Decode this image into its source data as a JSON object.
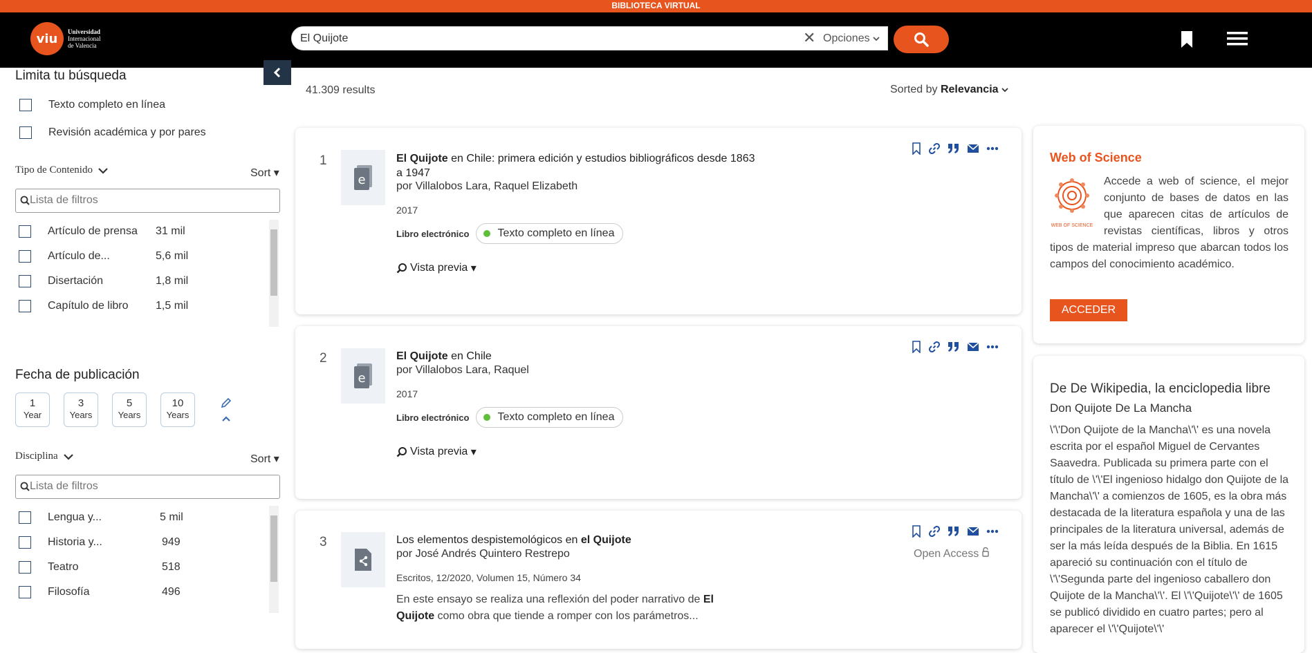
{
  "banner": "BIBLIOTECA VIRTUAL",
  "logo": {
    "mark": "viu",
    "line1": "Universidad",
    "line2": "Internacional",
    "line3": "de Valencia"
  },
  "search": {
    "value": "El Quijote",
    "options_label": "Opciones",
    "icon": "search-icon"
  },
  "sidebar": {
    "title": "Limita tu búsqueda",
    "checks": [
      "Texto completo en línea",
      "Revisión académica y por pares"
    ],
    "tipo": {
      "heading": "Tipo de Contenido",
      "sort": "Sort",
      "filter_placeholder": "Lista de filtros",
      "items": [
        {
          "label": "Artículo de prensa",
          "count": "31 mil"
        },
        {
          "label": "Artículo de...",
          "count": "5,6 mil"
        },
        {
          "label": "Disertación",
          "count": "1,8 mil"
        },
        {
          "label": "Capítulo de libro",
          "count": "1,5 mil"
        }
      ]
    },
    "fecha": {
      "heading": "Fecha de publicación",
      "buttons": [
        {
          "n": "1",
          "u": "Year"
        },
        {
          "n": "3",
          "u": "Years"
        },
        {
          "n": "5",
          "u": "Years"
        },
        {
          "n": "10",
          "u": "Years"
        }
      ]
    },
    "disciplina": {
      "heading": "Disciplina",
      "sort": "Sort",
      "filter_placeholder": "Lista de filtros",
      "items": [
        {
          "label": "Lengua y...",
          "count": "5 mil"
        },
        {
          "label": "Historia y...",
          "count": "949"
        },
        {
          "label": "Teatro",
          "count": "518"
        },
        {
          "label": "Filosofía",
          "count": "496"
        }
      ]
    }
  },
  "results": {
    "count": "41.309 results",
    "sorted_prefix": "Sorted by",
    "sorted_value": "Relevancia",
    "items": [
      {
        "rank": "1",
        "title_bold": "El Quijote",
        "title_rest": " en Chile: primera edición y estudios bibliográficos desde 1863 a 1947",
        "author_prefix": "por",
        "author": "Villalobos Lara, Raquel Elizabeth",
        "date": "2017",
        "type": "Libro electrónico",
        "availability": "Texto completo en línea",
        "preview": "Vista previa"
      },
      {
        "rank": "2",
        "title_bold": "El Quijote",
        "title_rest": " en Chile",
        "author_prefix": "por",
        "author": "Villalobos Lara, Raquel",
        "date": "2017",
        "type": "Libro electrónico",
        "availability": "Texto completo en línea",
        "preview": "Vista previa"
      },
      {
        "rank": "3",
        "title_rest": "Los elementos despistemológicos en ",
        "title_bold": "el Quijote",
        "author_prefix": "por",
        "author": "José Andrés Quintero Restrepo",
        "date": "Escritos, 12/2020, Volumen 15, Número 34",
        "open_access": "Open Access",
        "snippet_pre": "En este ensayo se realiza una reflexión del poder narrativo de ",
        "snippet_bold": "El Quijote",
        "snippet_post": " como obra que tiende a romper con los parámetros..."
      }
    ]
  },
  "wos": {
    "title": "Web of Science",
    "logo_caption": "WEB OF SCIENCE",
    "text": "Accede a web of science, el mejor conjunto de bases de datos en las que aparecen citas de artículos de revistas científicas, libros y otros tipos de material impreso que abarcan todos los campos del conocimiento académico.",
    "button": "ACCEDER"
  },
  "wiki": {
    "heading": "De De Wikipedia, la enciclopedia libre",
    "subheading": "Don Quijote De La Mancha",
    "text": "\\'\\'Don Quijote de la Mancha\\'\\' es una novela escrita por el español Miguel de Cervantes Saavedra. Publicada su primera parte con el título de \\'\\'El ingenioso hidalgo don Quijote de la Mancha\\'\\' a comienzos de 1605, es la obra más destacada de la literatura española y una de las principales de la literatura universal, además de ser la más leída después de la Biblia. En 1615 apareció su continuación con el título de \\'\\'Segunda parte del ingenioso caballero don Quijote de la Mancha\\'\\'. El \\'\\'Quijote\\'\\' de 1605 se publicó dividido en cuatro partes; pero al aparecer el \\'\\'Quijote\\'\\'"
  },
  "colors": {
    "accent": "#e8541e",
    "header": "#000000",
    "link_icons": "#1f4f9e",
    "available": "#5dbf3a"
  }
}
